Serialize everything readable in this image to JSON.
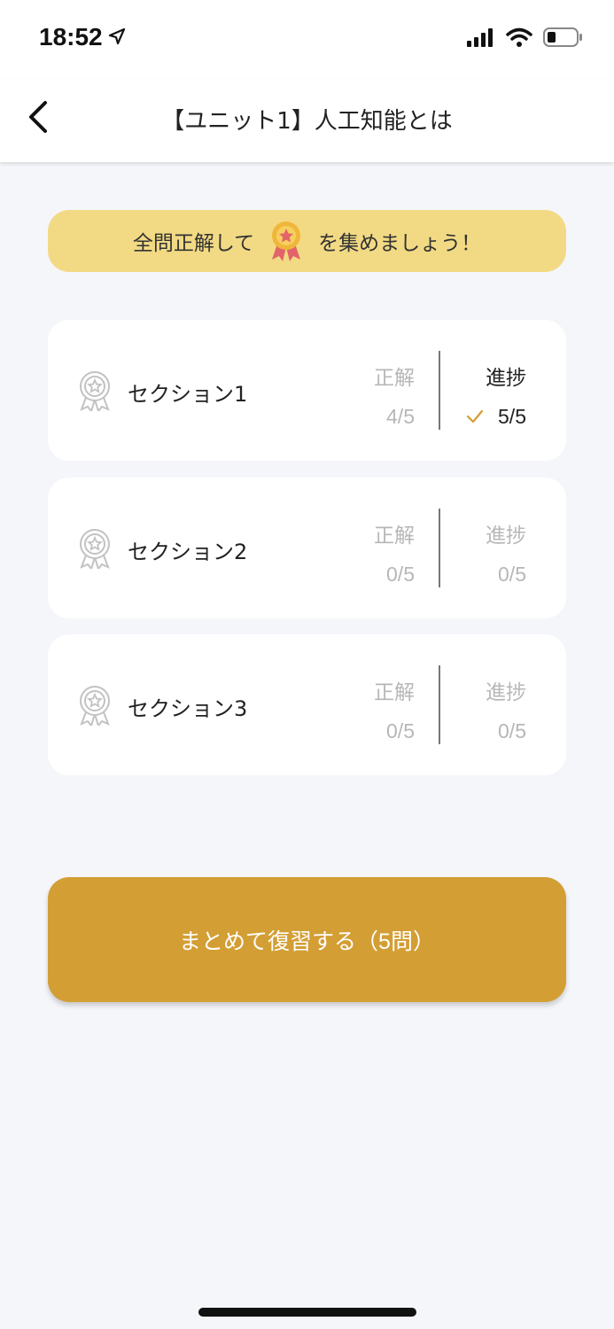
{
  "status_bar": {
    "time": "18:52",
    "location_icon": "location-arrow-icon",
    "signal_icon": "cellular-signal-icon",
    "wifi_icon": "wifi-icon",
    "battery_icon": "battery-low-icon"
  },
  "nav": {
    "title": "【ユニット1】人工知能とは",
    "back_icon": "chevron-left-icon"
  },
  "banner": {
    "text_before": "全問正解して",
    "text_after": "を集めましょう！",
    "icon": "gold-medal-icon",
    "bg_color": "#f2da84"
  },
  "sections": [
    {
      "name": "セクション1",
      "correct_label": "正解",
      "correct_value": "4/5",
      "progress_label": "進捗",
      "progress_value": "5/5",
      "progress_complete": true,
      "icon": "ribbon-award-icon"
    },
    {
      "name": "セクション2",
      "correct_label": "正解",
      "correct_value": "0/5",
      "progress_label": "進捗",
      "progress_value": "0/5",
      "progress_complete": false,
      "icon": "ribbon-award-icon"
    },
    {
      "name": "セクション3",
      "correct_label": "正解",
      "correct_value": "0/5",
      "progress_label": "進捗",
      "progress_value": "0/5",
      "progress_complete": false,
      "icon": "ribbon-award-icon"
    }
  ],
  "review_button": {
    "label": "まとめて復習する（5問）",
    "color": "#d39e34"
  },
  "colors": {
    "accent": "#d39e34",
    "background": "#f5f6fa",
    "muted_text": "#b7b7b7"
  }
}
